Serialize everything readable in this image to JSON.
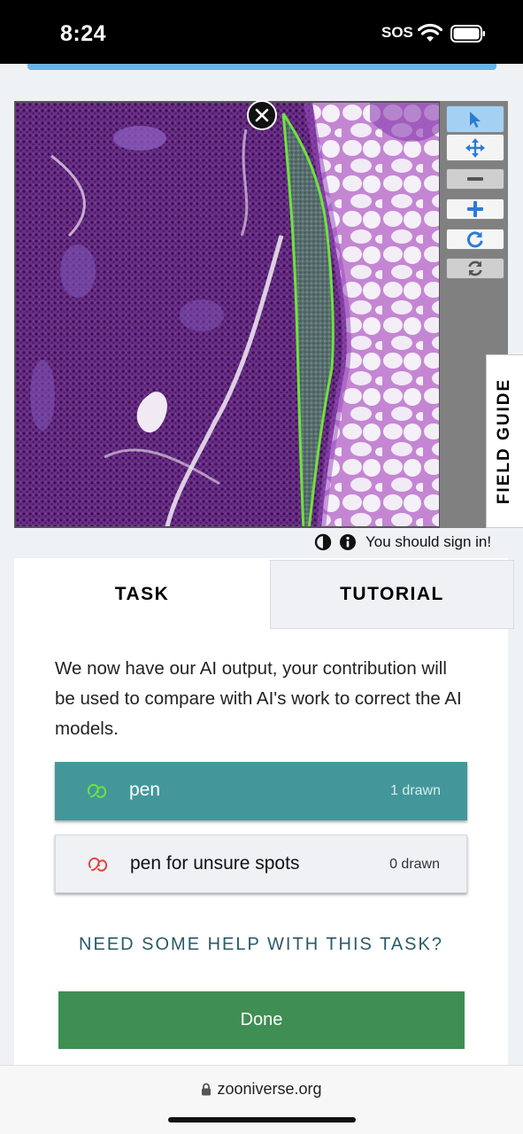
{
  "status_bar": {
    "time": "8:24",
    "sos": "SOS",
    "icons": [
      "wifi-icon",
      "battery-icon"
    ]
  },
  "viewer": {
    "image_description_icon": "microscopy-tissue-image",
    "annotation_color": "#6de33c",
    "close_icon": "close-icon",
    "toolbar": {
      "buttons": [
        "cursor-select-icon",
        "pan-move-icon",
        "zoom-out-icon",
        "zoom-in-icon",
        "rotate-icon",
        "reset-view-icon"
      ],
      "active_color": "#a4d1f3"
    },
    "field_guide_label": "FIELD GUIDE"
  },
  "meta": {
    "icons": [
      "contrast-icon",
      "info-icon"
    ],
    "sign_in_text": "You should sign in!"
  },
  "tabs": {
    "task": "TASK",
    "tutorial": "TUTORIAL"
  },
  "task": {
    "instruction": "We now have our AI output, your contribution will be used to compare with AI's work to correct the AI models.",
    "tools": [
      {
        "label": "pen",
        "count": "1 drawn",
        "icon_color": "#6de33c",
        "selected": true
      },
      {
        "label": "pen for unsure spots",
        "count": "0 drawn",
        "icon_color": "#e2453c",
        "selected": false
      }
    ],
    "help_link": "NEED SOME HELP WITH THIS TASK?",
    "done_label": "Done"
  },
  "colors": {
    "accent_strip": "#6cb3e4",
    "selected_tool": "#43979b",
    "done_button": "#3f8e53",
    "help_link": "#2a5a6a"
  },
  "browser": {
    "url": "zooniverse.org"
  }
}
